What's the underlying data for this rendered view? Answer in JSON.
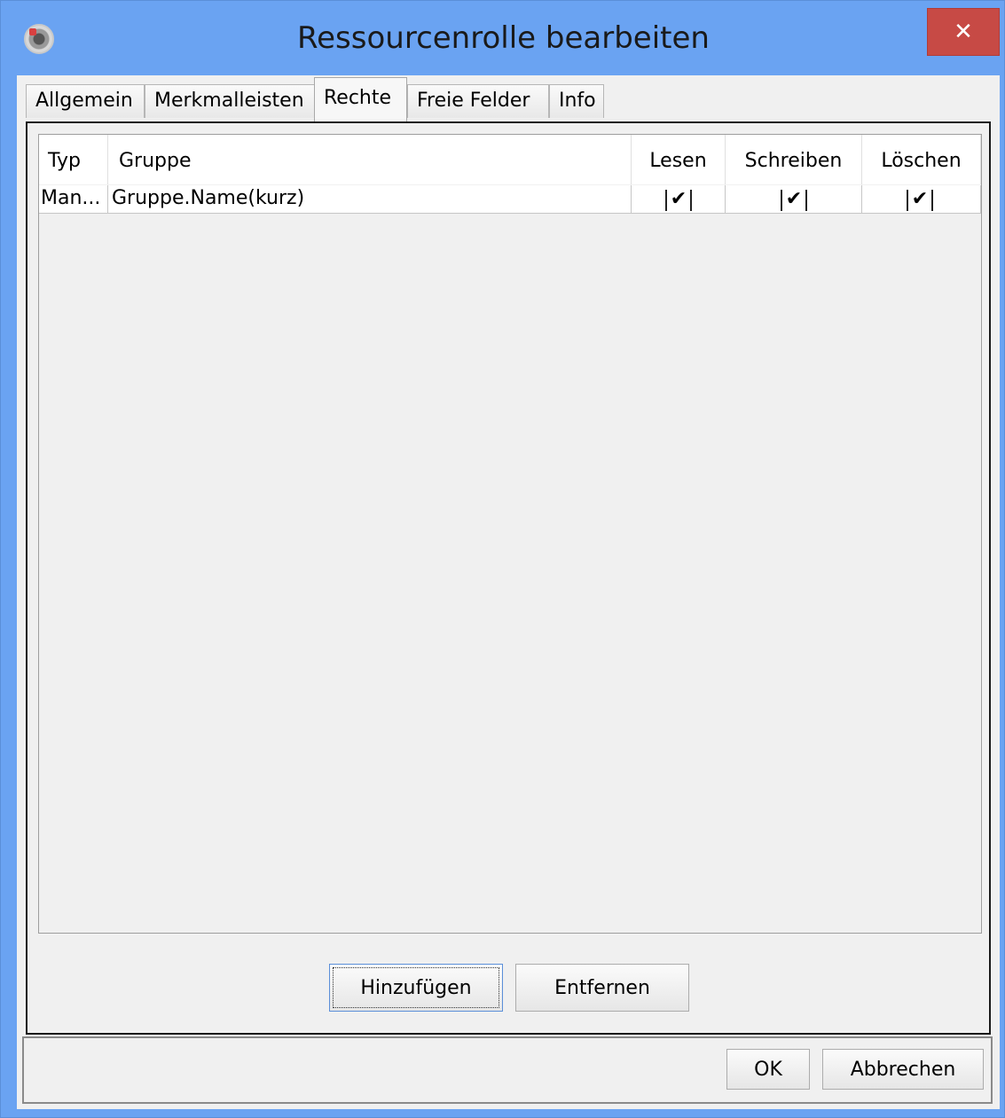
{
  "window": {
    "title": "Ressourcenrolle bearbeiten",
    "close_glyph": "✕"
  },
  "tabs": [
    {
      "label": "Allgemein",
      "active": false
    },
    {
      "label": "Merkmalleisten",
      "active": false
    },
    {
      "label": "Rechte",
      "active": true
    },
    {
      "label": "Freie Felder",
      "active": false
    },
    {
      "label": "Info",
      "active": false
    }
  ],
  "table": {
    "columns": [
      "Typ",
      "Gruppe",
      "Lesen",
      "Schreiben",
      "Löschen"
    ],
    "rows": [
      {
        "typ": "Man...",
        "gruppe": "Gruppe.Name(kurz)",
        "lesen": "✔",
        "schreiben": "✔",
        "loeschen": "✔"
      }
    ]
  },
  "panel_buttons": {
    "add": "Hinzufügen",
    "remove": "Entfernen"
  },
  "dialog_buttons": {
    "ok": "OK",
    "cancel": "Abbrechen"
  }
}
